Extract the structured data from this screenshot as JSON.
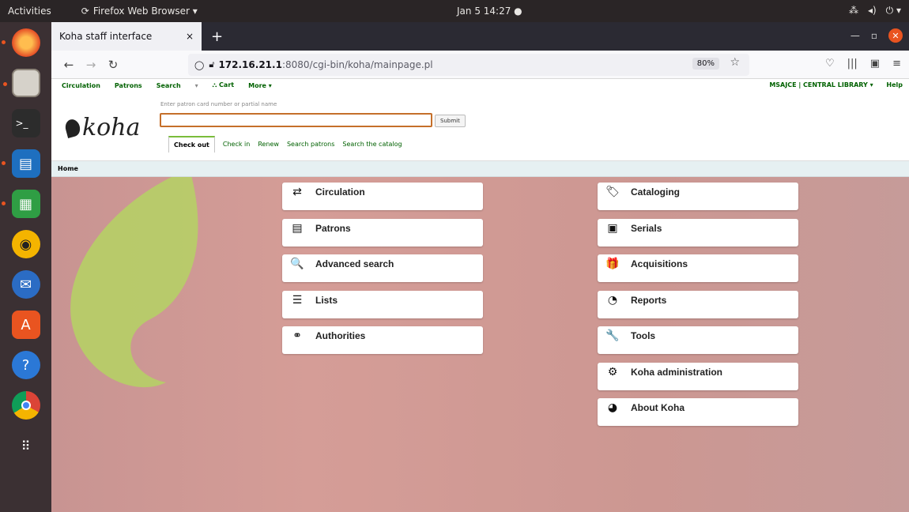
{
  "topbar": {
    "activities": "Activities",
    "app": "Firefox Web Browser ▾",
    "clock": "Jan 5  14:27  ●",
    "sys": [
      "⁂",
      "◂)",
      "⏻ ▾"
    ]
  },
  "browser": {
    "tab_title": "Koha staff interface",
    "tab_close": "×",
    "new_tab": "+",
    "url_host": "172.16.21.1",
    "url_path": ":8080/cgi-bin/koha/mainpage.pl",
    "zoom": "80%"
  },
  "koha": {
    "nav": [
      "Circulation",
      "Patrons",
      "Search",
      "▾",
      "⛬ Cart",
      "More ▾"
    ],
    "nav_right": [
      "MSAJCE | CENTRAL LIBRARY ▾",
      "Help"
    ],
    "logo": "koha",
    "search_hint": "Enter patron card number or partial name",
    "submit": "Submit",
    "tabs": [
      "Check out",
      "Check in",
      "Renew",
      "Search patrons",
      "Search the catalog"
    ],
    "breadcrumb": "Home",
    "left_modules": [
      {
        "label": "Circulation",
        "icon": "⇄"
      },
      {
        "label": "Patrons",
        "icon": "▤"
      },
      {
        "label": "Advanced search",
        "icon": "🔍"
      },
      {
        "label": "Lists",
        "icon": "☰"
      },
      {
        "label": "Authorities",
        "icon": "⚭"
      }
    ],
    "right_modules": [
      {
        "label": "Cataloging",
        "icon": "🏷"
      },
      {
        "label": "Serials",
        "icon": "▣"
      },
      {
        "label": "Acquisitions",
        "icon": "🎁"
      },
      {
        "label": "Reports",
        "icon": "◔"
      },
      {
        "label": "Tools",
        "icon": "🔧"
      },
      {
        "label": "Koha administration",
        "icon": "⚙"
      },
      {
        "label": "About Koha",
        "icon": "◕"
      }
    ]
  }
}
